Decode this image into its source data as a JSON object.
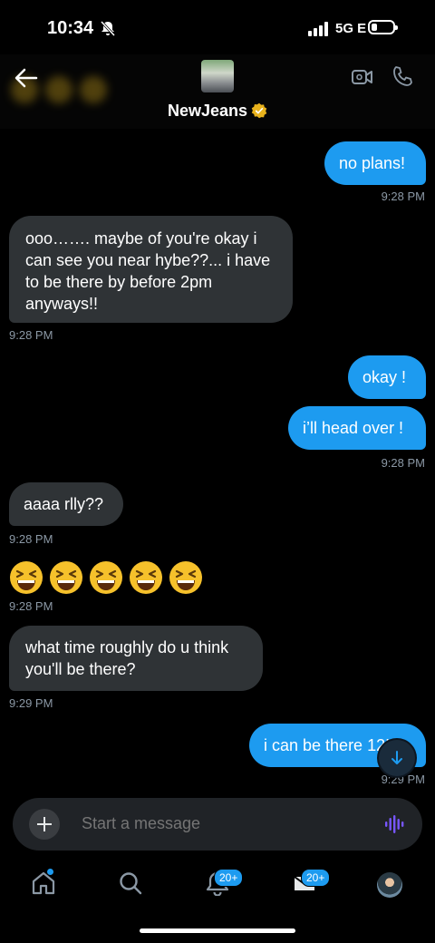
{
  "status": {
    "time": "10:34",
    "network": "5G E"
  },
  "header": {
    "title": "NewJeans",
    "icons": [
      "back-arrow-icon",
      "group-avatar",
      "verified-badge-icon",
      "video-call-icon",
      "phone-icon"
    ]
  },
  "messages": [
    {
      "dir": "out",
      "text": "no plans!",
      "time": "9:28 PM"
    },
    {
      "dir": "in",
      "text": "ooo……. maybe of you're okay i can see you near hybe??... i have to be there by before 2pm anyways!!",
      "time": "9:28 PM"
    },
    {
      "dir": "out",
      "text": "okay !"
    },
    {
      "dir": "out",
      "text": "i’ll head over !",
      "time": "9:28 PM"
    },
    {
      "dir": "in",
      "text": "aaaa rlly??",
      "time": "9:28 PM"
    },
    {
      "dir": "in",
      "emoji": "grinning-squinting-face",
      "count": 5,
      "time": "9:28 PM"
    },
    {
      "dir": "in",
      "text": "what time roughly do u think you'll be there?",
      "time": "9:29 PM"
    },
    {
      "dir": "out",
      "text": "i can be there 12!",
      "time": "9:29 PM"
    }
  ],
  "composer": {
    "placeholder": "Start a message"
  },
  "tabbar": {
    "notifications_badge": "20+",
    "messages_badge": "20+"
  },
  "colors": {
    "accent": "#1d9bf0",
    "incoming": "#2f3336",
    "background": "#000000"
  }
}
